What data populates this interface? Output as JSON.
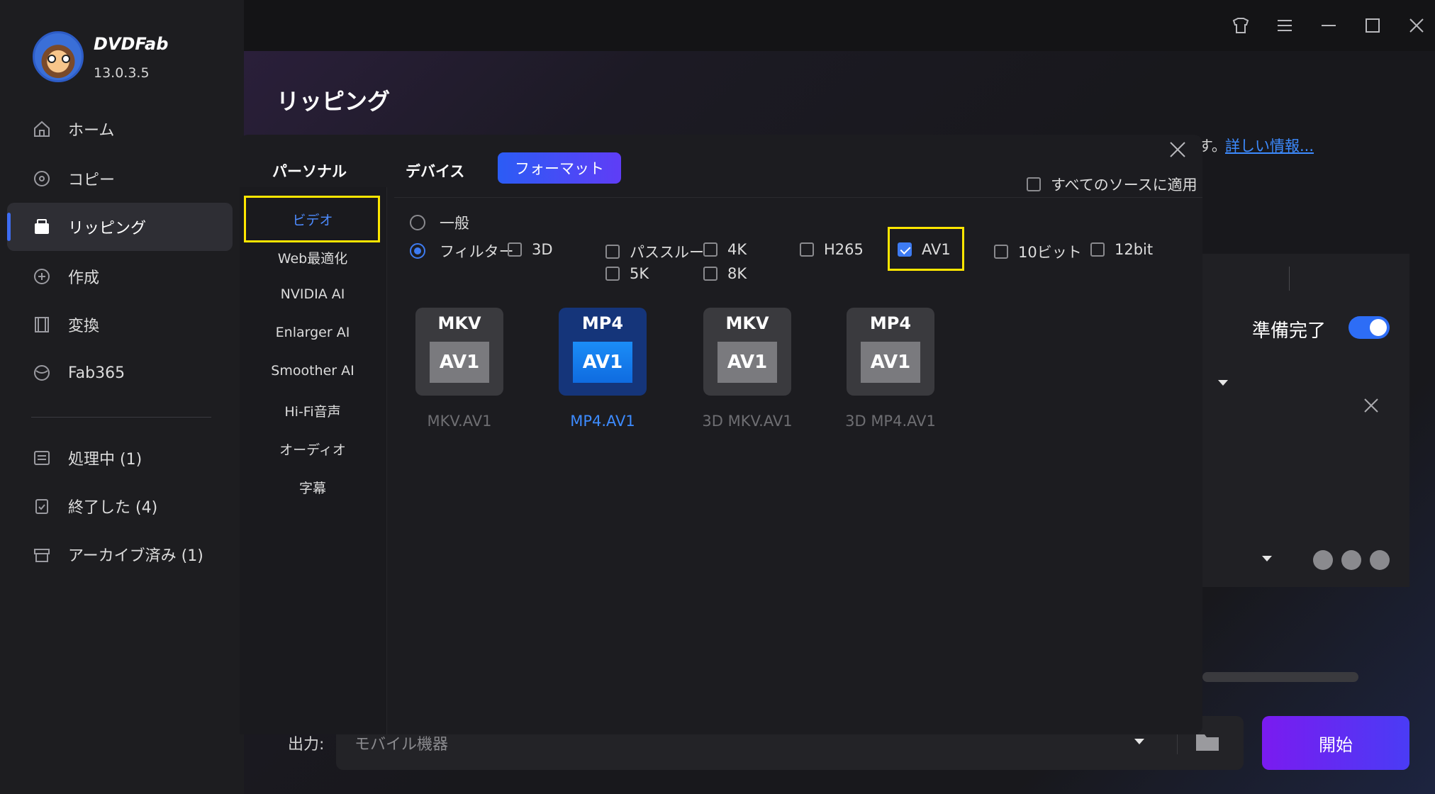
{
  "app": {
    "brand": "DVDFab",
    "version": "13.0.3.5"
  },
  "sidebar": {
    "items": [
      {
        "label": "ホーム",
        "icon": "home-icon"
      },
      {
        "label": "コピー",
        "icon": "copy-disc-icon"
      },
      {
        "label": "リッピング",
        "icon": "ripping-icon"
      },
      {
        "label": "作成",
        "icon": "creator-icon"
      },
      {
        "label": "変換",
        "icon": "converter-film-icon"
      },
      {
        "label": "Fab365",
        "icon": "fab365-icon"
      }
    ],
    "queue": [
      {
        "label": "処理中 (1)",
        "icon": "processing-list-icon"
      },
      {
        "label": "終了した (4)",
        "icon": "finished-clipboard-icon"
      },
      {
        "label": "アーカイブ済み (1)",
        "icon": "archive-box-icon"
      }
    ]
  },
  "main": {
    "title": "リッピング",
    "info_prefix": "す。",
    "info_link": "詳しい情報...",
    "ready_label": "準備完了",
    "output_label": "出力:",
    "output_value": "モバイル機器",
    "start_label": "開始"
  },
  "dialog": {
    "tabs": [
      "パーソナル",
      "デバイス",
      "フォーマット"
    ],
    "apply_all": "すべてのソースに適用",
    "categories": [
      "ビデオ",
      "Web最適化",
      "NVIDIA AI",
      "Enlarger AI",
      "Smoother AI",
      "Hi-Fi音声",
      "オーディオ",
      "字幕"
    ],
    "mode_general": "一般",
    "mode_filter": "フィルター",
    "filters": [
      "3D",
      "パススルー",
      "4K",
      "H265",
      "AV1",
      "10ビット",
      "12bit",
      "5K",
      "8K"
    ],
    "formats": [
      {
        "top": "MKV",
        "inner": "AV1",
        "label": "MKV.AV1"
      },
      {
        "top": "MP4",
        "inner": "AV1",
        "label": "MP4.AV1"
      },
      {
        "top": "MKV",
        "inner": "AV1",
        "label": "3D MKV.AV1"
      },
      {
        "top": "MP4",
        "inner": "AV1",
        "label": "3D MP4.AV1"
      }
    ]
  },
  "colors": {
    "accent": "#3d7bf2",
    "highlight": "#ffe600",
    "start_gradient_left": "#7a1bf0",
    "start_gradient_right": "#4a3cf5"
  }
}
